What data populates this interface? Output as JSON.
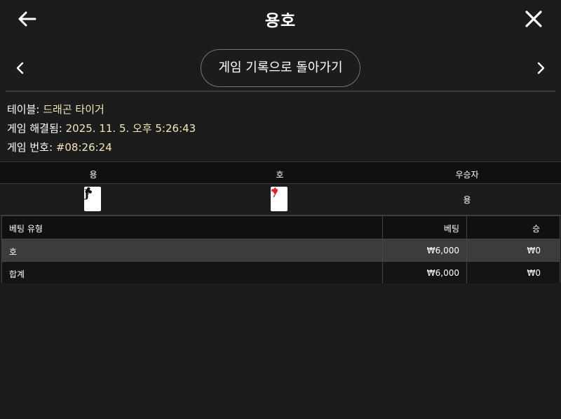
{
  "header": {
    "title": "용호",
    "back_icon": "arrow-left-icon",
    "close_icon": "close-icon"
  },
  "nav": {
    "history_button": "게임 기록으로 돌아가기",
    "prev_icon": "chevron-left-icon",
    "next_icon": "chevron-right-icon"
  },
  "info": {
    "table_label": "테이블:",
    "table_value": "드래곤 타이거",
    "resolved_label": "게임 해결됨:",
    "resolved_value": "2025. 11. 5. 오후 5:26:43",
    "game_no_label": "게임 번호:",
    "game_no_value": "#08:26:24"
  },
  "result": {
    "headers": [
      "용",
      "호",
      "우승자"
    ],
    "dragon_card": {
      "rank": "J",
      "suit": "♣",
      "color": "#111111"
    },
    "tiger_card": {
      "rank": "7",
      "suit": "♦",
      "color": "#d8232a"
    },
    "winner": "용"
  },
  "bets": {
    "headers": [
      "베팅 유형",
      "베팅",
      "승"
    ],
    "rows": [
      {
        "type": "호",
        "bet": "₩6,000",
        "win": "₩0"
      },
      {
        "type": "합계",
        "bet": "₩6,000",
        "win": "₩0"
      }
    ]
  }
}
